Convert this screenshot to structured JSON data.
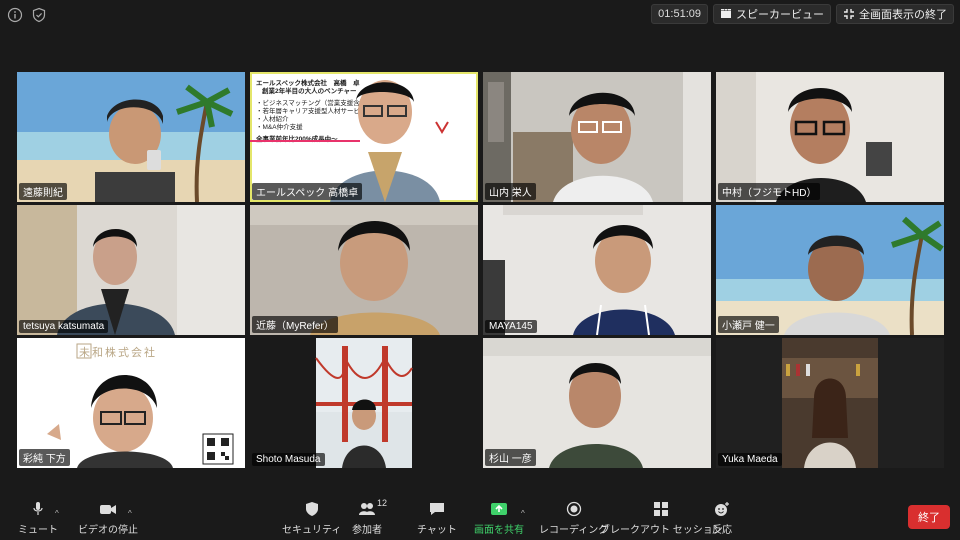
{
  "top_bar": {
    "timer": "01:51:09",
    "speaker_view": "スピーカービュー",
    "exit_fullscreen": "全画面表示の終了"
  },
  "participants": [
    {
      "name": "遠藤則紀",
      "background": "beach"
    },
    {
      "name": "エールスペック 高橋卓",
      "background": "slide",
      "active": true
    },
    {
      "name": "山内 栄人",
      "background": "room"
    },
    {
      "name": "中村（フジモトHD）",
      "background": "room"
    },
    {
      "name": "tetsuya katsumata",
      "background": "room"
    },
    {
      "name": "近藤（MyRefer）",
      "background": "room"
    },
    {
      "name": "MAYA145",
      "background": "room"
    },
    {
      "name": "小瀬戸 健一",
      "background": "beach"
    },
    {
      "name": "彩純 下方",
      "background": "logo"
    },
    {
      "name": "Shoto Masuda",
      "background": "bridge"
    },
    {
      "name": "杉山 一彦",
      "background": "room"
    },
    {
      "name": "Yuka Maeda",
      "background": "room"
    }
  ],
  "slide": {
    "title": "エールスペック株式会社　高橋　卓",
    "subtitle": "創業2年半目の大人のベンチャー",
    "bullets": [
      "・ビジネスマッチング（営業支援含）",
      "・若年層キャリア支援型人材サービス",
      "・人材紹介",
      "・M&A仲介支援"
    ],
    "growth": "全事業前年比200%成長中～"
  },
  "logo_tile": {
    "company": "未和株式会社"
  },
  "toolbar": {
    "mute": "ミュート",
    "stop_video": "ビデオの停止",
    "security": "セキュリティ",
    "participants": "参加者",
    "participants_count": "12",
    "chat": "チャット",
    "share_screen": "画面を共有",
    "recording": "レコーディング",
    "breakout": "ブレークアウト セッション",
    "reactions": "反応",
    "end": "終了"
  },
  "colors": {
    "active_border": "#e4e66a",
    "share_green": "#3fd16a",
    "end_red": "#d92f2f"
  }
}
